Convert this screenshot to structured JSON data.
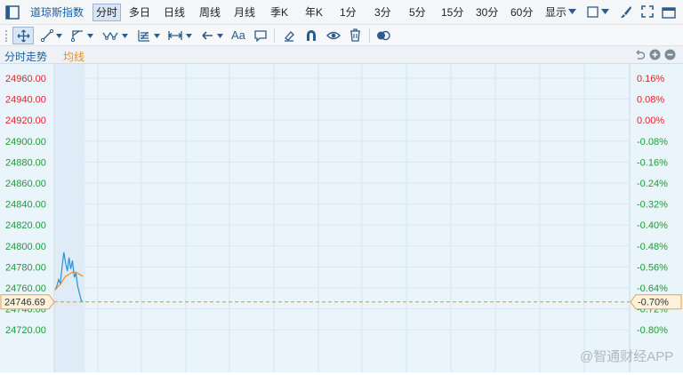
{
  "toolbar": {
    "index_name": "道琼斯指数",
    "active_period": "分时",
    "periods": [
      "多日",
      "日线",
      "周线",
      "月线",
      "季K",
      "年K",
      "1分",
      "3分",
      "5分",
      "15分",
      "30分",
      "60分"
    ],
    "display_label": "显示"
  },
  "drawbar": {
    "text_tool": "Aa"
  },
  "subbar": {
    "tab_label": "分时走势",
    "avg_label": "均线"
  },
  "chart": {
    "price_labels": [
      "24960.00",
      "24940.00",
      "24920.00",
      "24900.00",
      "24880.00",
      "24860.00",
      "24840.00",
      "24820.00",
      "24800.00",
      "24780.00",
      "24760.00",
      "24740.00",
      "24720.00"
    ],
    "pct_labels": [
      "0.16%",
      "0.08%",
      "0.00%",
      "-0.08%",
      "-0.16%",
      "-0.24%",
      "-0.32%",
      "-0.40%",
      "-0.48%",
      "-0.56%",
      "-0.64%",
      "-0.72%",
      "-0.80%"
    ],
    "current_price": "24746.69",
    "current_pct": "-0.70%",
    "watermark": "@智通财经APP",
    "colors": {
      "up": "#e0242b",
      "down": "#1e9a3a",
      "neutral": "#e0242b",
      "price_line": "#2a8fd6",
      "avg_line": "#f08c1e",
      "marker_border": "#e8a24a",
      "marker_fill": "#fdf3dc"
    }
  },
  "chart_data": {
    "type": "line",
    "title": "",
    "ylim": [
      24710,
      24970
    ],
    "yticks": [
      24960,
      24940,
      24920,
      24900,
      24880,
      24860,
      24840,
      24820,
      24800,
      24780,
      24760,
      24740,
      24720
    ],
    "pct_ticks": [
      "0.16%",
      "0.08%",
      "0.00%",
      "-0.08%",
      "-0.16%",
      "-0.24%",
      "-0.32%",
      "-0.40%",
      "-0.48%",
      "-0.56%",
      "-0.64%",
      "-0.72%",
      "-0.80%"
    ],
    "grid": true,
    "series": [
      {
        "values": [
          24758,
          24762,
          24768,
          24764,
          24780,
          24794,
          24784,
          24776,
          24789,
          24778,
          24786,
          24770,
          24774,
          24762,
          24755,
          24748,
          24746.69
        ]
      },
      {
        "values": [
          24758,
          24760,
          24762,
          24763,
          24766,
          24769,
          24771,
          24772,
          24773,
          24774,
          24775,
          24775,
          24775,
          24774,
          24773,
          24772,
          24771
        ]
      }
    ],
    "current_value": 24746.69
  }
}
